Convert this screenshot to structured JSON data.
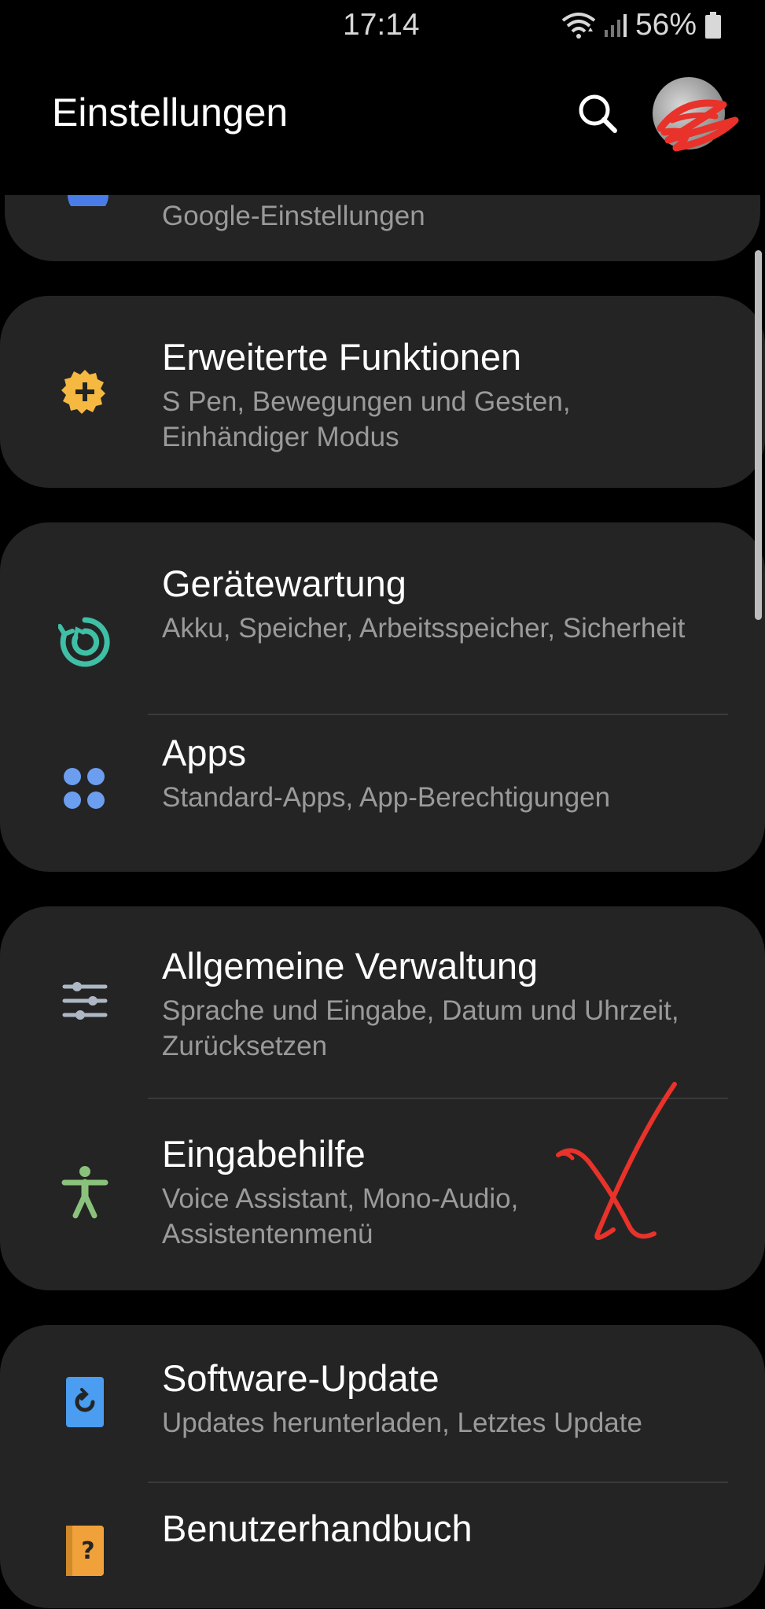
{
  "status_bar": {
    "time": "17:14",
    "battery": "56%",
    "icons": [
      "wifi-icon",
      "cellular-signal-icon",
      "battery-icon"
    ]
  },
  "header": {
    "title": "Einstellungen",
    "icons": [
      "search-icon",
      "profile-avatar"
    ]
  },
  "settings": {
    "google": {
      "subtitle": "Google-Einstellungen",
      "icon": "google-icon"
    },
    "erweiterte": {
      "title": "Erweiterte Funktionen",
      "subtitle": "S Pen, Bewegungen und Gesten, Einhändiger Modus",
      "icon": "gear-plus-icon",
      "color": "#f5b942"
    },
    "geraetewartung": {
      "title": "Gerätewartung",
      "subtitle": "Akku, Speicher, Arbeitsspeicher, Sicherheit",
      "icon": "device-care-icon",
      "color": "#3fbfa5"
    },
    "apps": {
      "title": "Apps",
      "subtitle": "Standard-Apps, App-Berechtigungen",
      "icon": "apps-grid-icon",
      "color": "#6c9ef0"
    },
    "verwaltung": {
      "title": "Allgemeine Verwaltung",
      "subtitle": "Sprache und Eingabe, Datum und Uhrzeit, Zurücksetzen",
      "icon": "sliders-icon",
      "color": "#aeb8c4"
    },
    "eingabehilfe": {
      "title": "Eingabehilfe",
      "subtitle": "Voice Assistant, Mono-Audio, Assistentenmenü",
      "icon": "accessibility-icon",
      "color": "#8ac27c"
    },
    "software_update": {
      "title": "Software-Update",
      "subtitle": "Updates herunterladen, Letztes Update",
      "icon": "software-update-icon",
      "color": "#4a9df0"
    },
    "handbuch": {
      "title": "Benutzerhandbuch",
      "icon": "user-manual-icon",
      "color": "#f0a13a"
    }
  }
}
